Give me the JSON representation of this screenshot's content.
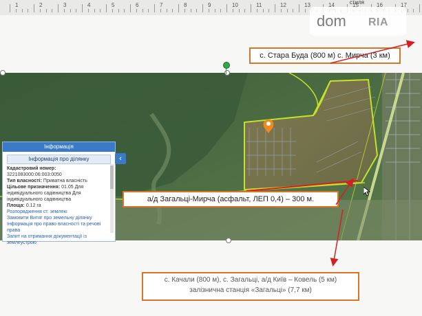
{
  "ruler": {
    "numbers": [
      "1",
      "2",
      "3",
      "4",
      "5",
      "6",
      "7",
      "8",
      "9",
      "10",
      "11",
      "12",
      "13",
      "14",
      "15",
      "16",
      "17"
    ],
    "top_label": "стиля"
  },
  "watermark": {
    "brand_dom": "dom",
    "brand_ria": "RIA"
  },
  "callouts": {
    "top": "с. Стара Буда (800 м) с. Мирча (3 км)",
    "road": "а/д Загальці-Мирча (асфальт, ЛЕП 0,4) – 300 м.",
    "bottom_line1": "с. Качали (800 м), с. Загальці, а/д Київ – Ковель (5 км)",
    "bottom_line2": "залізнична станція «Загальці» (7,7 км)"
  },
  "info_panel": {
    "header": "Інформація",
    "subheader": "Інформація про ділянку",
    "cadastral_label": "Кадастровий номер:",
    "cadastral_value": "3221083000:06:003:0050",
    "ownership_label": "Тип власності:",
    "ownership_value": "Приватна власність",
    "purpose_label": "Цільове призначення:",
    "purpose_value": "01.05 Для індивідуального садівництва Для індивідуального садівництва",
    "area_label": "Площа:",
    "area_value": "0.12 га",
    "link_disposal": "Розпорядження ст. землею",
    "link_order_extract": "Замовити Витяг про земельну ділянку",
    "link_ownership_info": "Інформація про право власності та речові права",
    "link_documentation": "Запит на отримання документації із землеустрою"
  },
  "colors": {
    "callout_border": "#d7762b",
    "panel_header": "#3a7bc8",
    "parcel_outline": "#c6e02b",
    "marker": "#f08a1c",
    "road_line": "#d42020"
  },
  "icons": {
    "collapse": "chevron-left-icon",
    "marker": "map-pin-icon",
    "cursor": "mouse-cursor-icon"
  }
}
